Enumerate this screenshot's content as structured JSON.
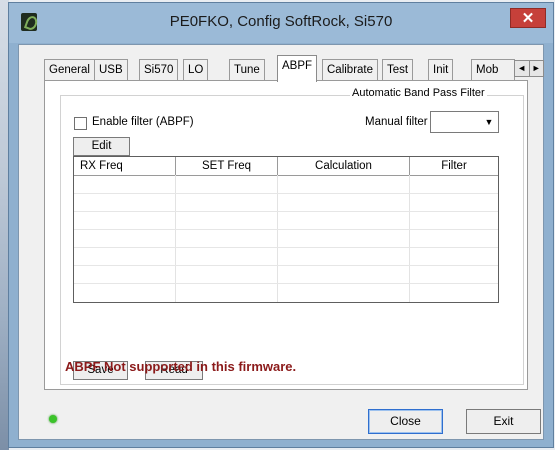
{
  "window": {
    "title": "PE0FKO, Config SoftRock, Si570"
  },
  "tabs": [
    {
      "label": "General"
    },
    {
      "label": "USB"
    },
    {
      "label": "Si570"
    },
    {
      "label": "LO"
    },
    {
      "label": "Tune"
    },
    {
      "label": "ABPF",
      "active": true
    },
    {
      "label": "Calibrate"
    },
    {
      "label": "Test"
    },
    {
      "label": "Init"
    },
    {
      "label": "Mob"
    }
  ],
  "tab_scroll": {
    "left": "◄",
    "right": "►"
  },
  "abpf": {
    "group_label": "Automatic Band Pass Filter",
    "enable_label": "Enable filter (ABPF)",
    "enable_checked": false,
    "manual_label": "Manual filter",
    "manual_value": "",
    "edit_label": "Edit",
    "columns": [
      "RX Freq",
      "SET Freq",
      "Calculation",
      "Filter"
    ],
    "rows": [],
    "save_label": "Save",
    "read_label": "Read",
    "status_message": "ABPF Not supported in this firmware.",
    "status_color": "#8b1a1a"
  },
  "footer": {
    "led_color": "#3bc32a",
    "close_label": "Close",
    "exit_label": "Exit"
  }
}
